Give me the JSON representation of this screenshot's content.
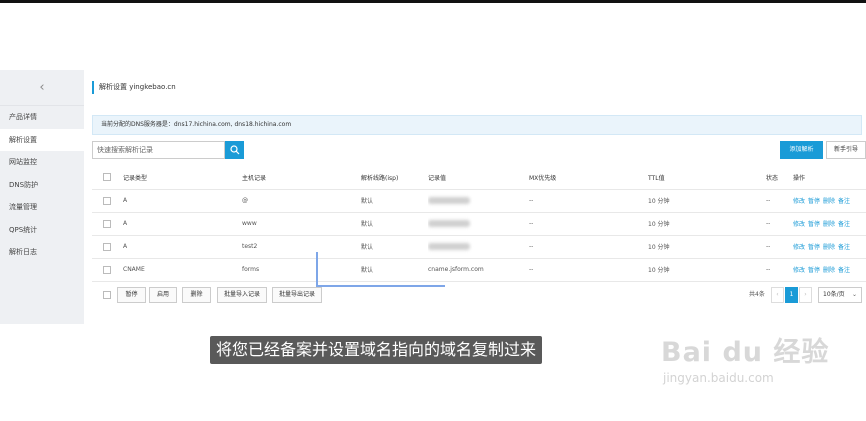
{
  "sidebar": {
    "items": [
      {
        "label": "产品详情"
      },
      {
        "label": "解析设置"
      },
      {
        "label": "网站监控"
      },
      {
        "label": "DNS防护"
      },
      {
        "label": "流量管理"
      },
      {
        "label": "QPS统计"
      },
      {
        "label": "解析日志"
      }
    ],
    "active_index": 1
  },
  "header": {
    "title": "解析设置 yingkebao.cn"
  },
  "dns_info": "当前分配的DNS服务器是：dns17.hichina.com, dns18.hichina.com",
  "search": {
    "placeholder": "快速搜索解析记录"
  },
  "toolbar": {
    "add_label": "添加解析",
    "guide_label": "新手引导"
  },
  "table": {
    "headers": [
      "记录类型",
      "主机记录",
      "解析线路(isp)",
      "记录值",
      "MX优先级",
      "TTL值",
      "状态",
      "操作"
    ],
    "rows": [
      {
        "type": "A",
        "host": "@",
        "line": "默认",
        "value": "",
        "mx": "--",
        "ttl": "10 分钟",
        "status": "--"
      },
      {
        "type": "A",
        "host": "www",
        "line": "默认",
        "value": "",
        "mx": "--",
        "ttl": "10 分钟",
        "status": "--"
      },
      {
        "type": "A",
        "host": "test2",
        "line": "默认",
        "value": "",
        "mx": "--",
        "ttl": "10 分钟",
        "status": "--"
      },
      {
        "type": "CNAME",
        "host": "forms",
        "line": "默认",
        "value": "cname.jsform.com",
        "mx": "--",
        "ttl": "10 分钟",
        "status": "--"
      }
    ],
    "actions": [
      "修改",
      "暂停",
      "删除",
      "备注"
    ]
  },
  "footer": {
    "buttons": [
      "暂停",
      "启用",
      "删除",
      "批量导入记录",
      "批量导出记录"
    ],
    "total": "共4条",
    "current_page": "1",
    "page_size": "10条/页"
  },
  "subtitle": "将您已经备案并设置域名指向的域名复制过来",
  "watermark": {
    "brand": "Bai du 经验",
    "url": "jingyan.baidu.com"
  },
  "colors": {
    "accent": "#1a9bd7"
  }
}
